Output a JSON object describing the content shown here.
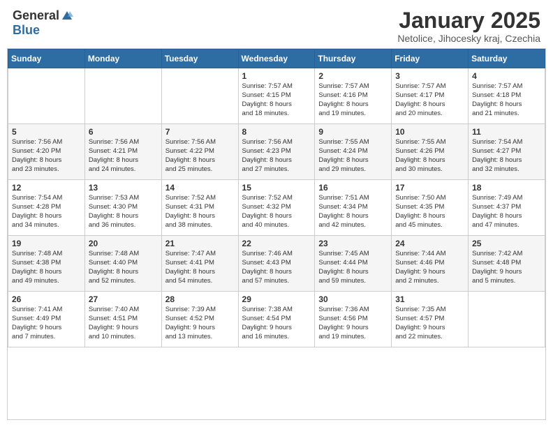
{
  "header": {
    "logo_general": "General",
    "logo_blue": "Blue",
    "month": "January 2025",
    "location": "Netolice, Jihocesky kraj, Czechia"
  },
  "weekdays": [
    "Sunday",
    "Monday",
    "Tuesday",
    "Wednesday",
    "Thursday",
    "Friday",
    "Saturday"
  ],
  "weeks": [
    [
      {
        "day": null,
        "info": null
      },
      {
        "day": null,
        "info": null
      },
      {
        "day": null,
        "info": null
      },
      {
        "day": "1",
        "info": "Sunrise: 7:57 AM\nSunset: 4:15 PM\nDaylight: 8 hours\nand 18 minutes."
      },
      {
        "day": "2",
        "info": "Sunrise: 7:57 AM\nSunset: 4:16 PM\nDaylight: 8 hours\nand 19 minutes."
      },
      {
        "day": "3",
        "info": "Sunrise: 7:57 AM\nSunset: 4:17 PM\nDaylight: 8 hours\nand 20 minutes."
      },
      {
        "day": "4",
        "info": "Sunrise: 7:57 AM\nSunset: 4:18 PM\nDaylight: 8 hours\nand 21 minutes."
      }
    ],
    [
      {
        "day": "5",
        "info": "Sunrise: 7:56 AM\nSunset: 4:20 PM\nDaylight: 8 hours\nand 23 minutes."
      },
      {
        "day": "6",
        "info": "Sunrise: 7:56 AM\nSunset: 4:21 PM\nDaylight: 8 hours\nand 24 minutes."
      },
      {
        "day": "7",
        "info": "Sunrise: 7:56 AM\nSunset: 4:22 PM\nDaylight: 8 hours\nand 25 minutes."
      },
      {
        "day": "8",
        "info": "Sunrise: 7:56 AM\nSunset: 4:23 PM\nDaylight: 8 hours\nand 27 minutes."
      },
      {
        "day": "9",
        "info": "Sunrise: 7:55 AM\nSunset: 4:24 PM\nDaylight: 8 hours\nand 29 minutes."
      },
      {
        "day": "10",
        "info": "Sunrise: 7:55 AM\nSunset: 4:26 PM\nDaylight: 8 hours\nand 30 minutes."
      },
      {
        "day": "11",
        "info": "Sunrise: 7:54 AM\nSunset: 4:27 PM\nDaylight: 8 hours\nand 32 minutes."
      }
    ],
    [
      {
        "day": "12",
        "info": "Sunrise: 7:54 AM\nSunset: 4:28 PM\nDaylight: 8 hours\nand 34 minutes."
      },
      {
        "day": "13",
        "info": "Sunrise: 7:53 AM\nSunset: 4:30 PM\nDaylight: 8 hours\nand 36 minutes."
      },
      {
        "day": "14",
        "info": "Sunrise: 7:52 AM\nSunset: 4:31 PM\nDaylight: 8 hours\nand 38 minutes."
      },
      {
        "day": "15",
        "info": "Sunrise: 7:52 AM\nSunset: 4:32 PM\nDaylight: 8 hours\nand 40 minutes."
      },
      {
        "day": "16",
        "info": "Sunrise: 7:51 AM\nSunset: 4:34 PM\nDaylight: 8 hours\nand 42 minutes."
      },
      {
        "day": "17",
        "info": "Sunrise: 7:50 AM\nSunset: 4:35 PM\nDaylight: 8 hours\nand 45 minutes."
      },
      {
        "day": "18",
        "info": "Sunrise: 7:49 AM\nSunset: 4:37 PM\nDaylight: 8 hours\nand 47 minutes."
      }
    ],
    [
      {
        "day": "19",
        "info": "Sunrise: 7:48 AM\nSunset: 4:38 PM\nDaylight: 8 hours\nand 49 minutes."
      },
      {
        "day": "20",
        "info": "Sunrise: 7:48 AM\nSunset: 4:40 PM\nDaylight: 8 hours\nand 52 minutes."
      },
      {
        "day": "21",
        "info": "Sunrise: 7:47 AM\nSunset: 4:41 PM\nDaylight: 8 hours\nand 54 minutes."
      },
      {
        "day": "22",
        "info": "Sunrise: 7:46 AM\nSunset: 4:43 PM\nDaylight: 8 hours\nand 57 minutes."
      },
      {
        "day": "23",
        "info": "Sunrise: 7:45 AM\nSunset: 4:44 PM\nDaylight: 8 hours\nand 59 minutes."
      },
      {
        "day": "24",
        "info": "Sunrise: 7:44 AM\nSunset: 4:46 PM\nDaylight: 9 hours\nand 2 minutes."
      },
      {
        "day": "25",
        "info": "Sunrise: 7:42 AM\nSunset: 4:48 PM\nDaylight: 9 hours\nand 5 minutes."
      }
    ],
    [
      {
        "day": "26",
        "info": "Sunrise: 7:41 AM\nSunset: 4:49 PM\nDaylight: 9 hours\nand 7 minutes."
      },
      {
        "day": "27",
        "info": "Sunrise: 7:40 AM\nSunset: 4:51 PM\nDaylight: 9 hours\nand 10 minutes."
      },
      {
        "day": "28",
        "info": "Sunrise: 7:39 AM\nSunset: 4:52 PM\nDaylight: 9 hours\nand 13 minutes."
      },
      {
        "day": "29",
        "info": "Sunrise: 7:38 AM\nSunset: 4:54 PM\nDaylight: 9 hours\nand 16 minutes."
      },
      {
        "day": "30",
        "info": "Sunrise: 7:36 AM\nSunset: 4:56 PM\nDaylight: 9 hours\nand 19 minutes."
      },
      {
        "day": "31",
        "info": "Sunrise: 7:35 AM\nSunset: 4:57 PM\nDaylight: 9 hours\nand 22 minutes."
      },
      {
        "day": null,
        "info": null
      }
    ]
  ]
}
